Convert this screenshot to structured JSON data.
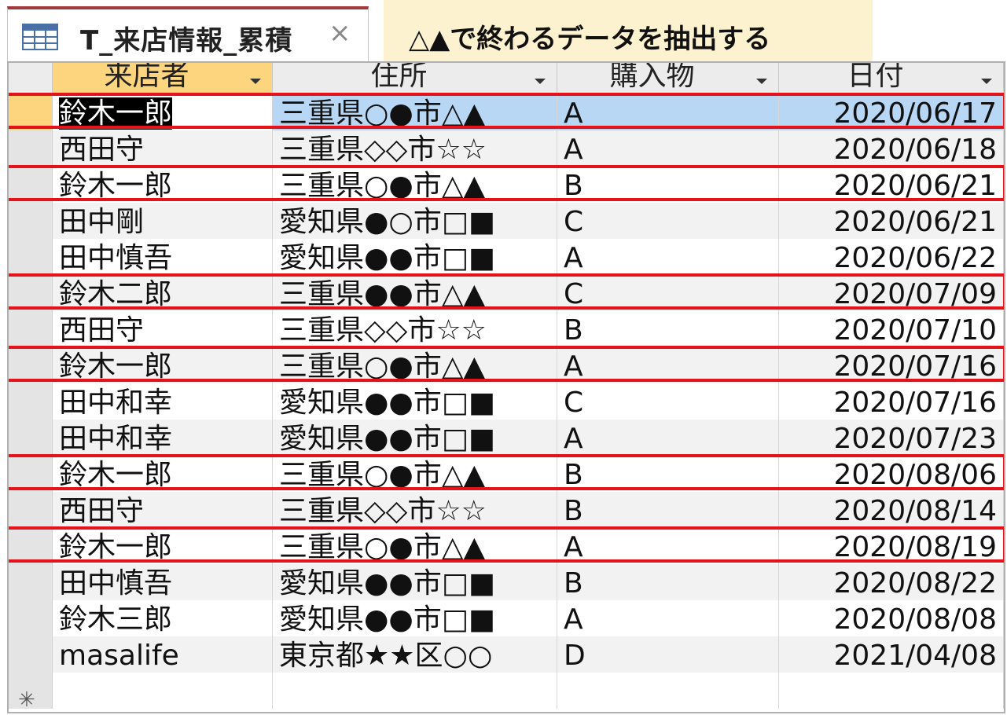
{
  "tab": {
    "title": "T_来店情報_累積",
    "close": "×"
  },
  "note": {
    "text": "△▲で終わるデータを抽出する"
  },
  "columns": [
    "来店者",
    "住所",
    "購入物",
    "日付"
  ],
  "rows": [
    {
      "name": "鈴木一郎",
      "address": "三重県○●市△▲",
      "item": "A",
      "date": "2020/06/17",
      "highlight": true
    },
    {
      "name": "西田守",
      "address": "三重県◇◇市☆☆",
      "item": "A",
      "date": "2020/06/18",
      "highlight": false
    },
    {
      "name": "鈴木一郎",
      "address": "三重県○●市△▲",
      "item": "B",
      "date": "2020/06/21",
      "highlight": true
    },
    {
      "name": "田中剛",
      "address": "愛知県●○市□■",
      "item": "C",
      "date": "2020/06/21",
      "highlight": false
    },
    {
      "name": "田中慎吾",
      "address": "愛知県●●市□■",
      "item": "A",
      "date": "2020/06/22",
      "highlight": false
    },
    {
      "name": "鈴木二郎",
      "address": "三重県●●市△▲",
      "item": "C",
      "date": "2020/07/09",
      "highlight": true
    },
    {
      "name": "西田守",
      "address": "三重県◇◇市☆☆",
      "item": "B",
      "date": "2020/07/10",
      "highlight": false
    },
    {
      "name": "鈴木一郎",
      "address": "三重県○●市△▲",
      "item": "A",
      "date": "2020/07/16",
      "highlight": true
    },
    {
      "name": "田中和幸",
      "address": "愛知県●●市□■",
      "item": "C",
      "date": "2020/07/16",
      "highlight": false
    },
    {
      "name": "田中和幸",
      "address": "愛知県●●市□■",
      "item": "A",
      "date": "2020/07/23",
      "highlight": false
    },
    {
      "name": "鈴木一郎",
      "address": "三重県○●市△▲",
      "item": "B",
      "date": "2020/08/06",
      "highlight": true
    },
    {
      "name": "西田守",
      "address": "三重県◇◇市☆☆",
      "item": "B",
      "date": "2020/08/14",
      "highlight": false
    },
    {
      "name": "鈴木一郎",
      "address": "三重県○●市△▲",
      "item": "A",
      "date": "2020/08/19",
      "highlight": true
    },
    {
      "name": "田中慎吾",
      "address": "愛知県●●市□■",
      "item": "B",
      "date": "2020/08/22",
      "highlight": false
    },
    {
      "name": "鈴木三郎",
      "address": "愛知県●●市□■",
      "item": "A",
      "date": "2020/08/08",
      "highlight": false
    },
    {
      "name": "masalife",
      "address": "東京都★★区○○",
      "item": "D",
      "date": "2021/04/08",
      "highlight": false
    }
  ],
  "new_row_symbol": "✳",
  "colors": {
    "accent": "#a4373a",
    "highlight_border": "#e6121a",
    "selected_row": "#b7d7f5",
    "selected_header": "#fdd57e",
    "note_bg": "#fdf2d0"
  }
}
